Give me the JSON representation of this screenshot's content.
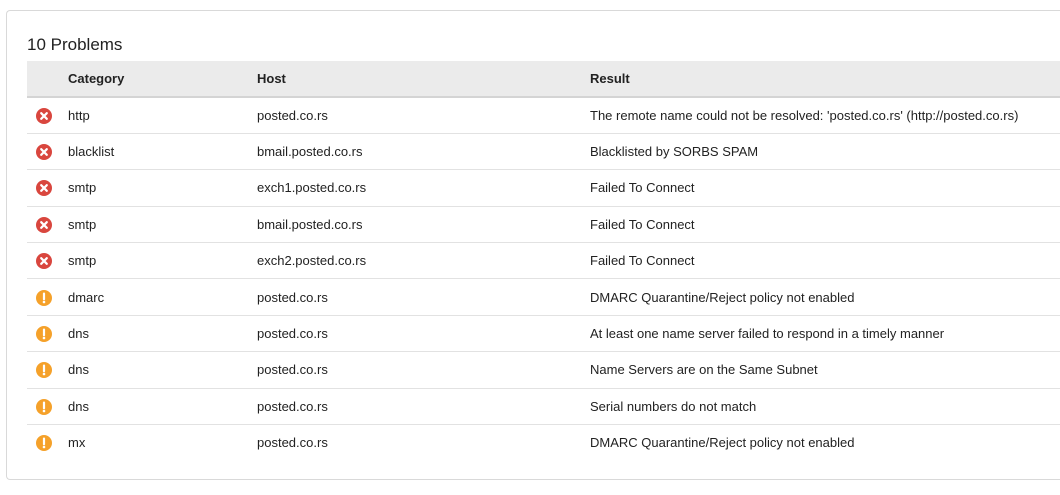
{
  "title": "10 Problems",
  "columns": {
    "category": "Category",
    "host": "Host",
    "result": "Result"
  },
  "colors": {
    "error": "#d9463e",
    "warning": "#f5a12a",
    "header_bg": "#ebebeb"
  },
  "rows": [
    {
      "severity": "error",
      "icon": "error-x-icon",
      "category": "http",
      "host": "posted.co.rs",
      "result": "The remote name could not be resolved: 'posted.co.rs' (http://posted.co.rs)"
    },
    {
      "severity": "error",
      "icon": "error-x-icon",
      "category": "blacklist",
      "host": "bmail.posted.co.rs",
      "result": "Blacklisted by SORBS SPAM"
    },
    {
      "severity": "error",
      "icon": "error-x-icon",
      "category": "smtp",
      "host": "exch1.posted.co.rs",
      "result": "Failed To Connect"
    },
    {
      "severity": "error",
      "icon": "error-x-icon",
      "category": "smtp",
      "host": "bmail.posted.co.rs",
      "result": "Failed To Connect"
    },
    {
      "severity": "error",
      "icon": "error-x-icon",
      "category": "smtp",
      "host": "exch2.posted.co.rs",
      "result": "Failed To Connect"
    },
    {
      "severity": "warning",
      "icon": "warning-exclamation-icon",
      "category": "dmarc",
      "host": "posted.co.rs",
      "result": "DMARC Quarantine/Reject policy not enabled"
    },
    {
      "severity": "warning",
      "icon": "warning-exclamation-icon",
      "category": "dns",
      "host": "posted.co.rs",
      "result": "At least one name server failed to respond in a timely manner"
    },
    {
      "severity": "warning",
      "icon": "warning-exclamation-icon",
      "category": "dns",
      "host": "posted.co.rs",
      "result": "Name Servers are on the Same Subnet"
    },
    {
      "severity": "warning",
      "icon": "warning-exclamation-icon",
      "category": "dns",
      "host": "posted.co.rs",
      "result": "Serial numbers do not match"
    },
    {
      "severity": "warning",
      "icon": "warning-exclamation-icon",
      "category": "mx",
      "host": "posted.co.rs",
      "result": "DMARC Quarantine/Reject policy not enabled"
    }
  ]
}
